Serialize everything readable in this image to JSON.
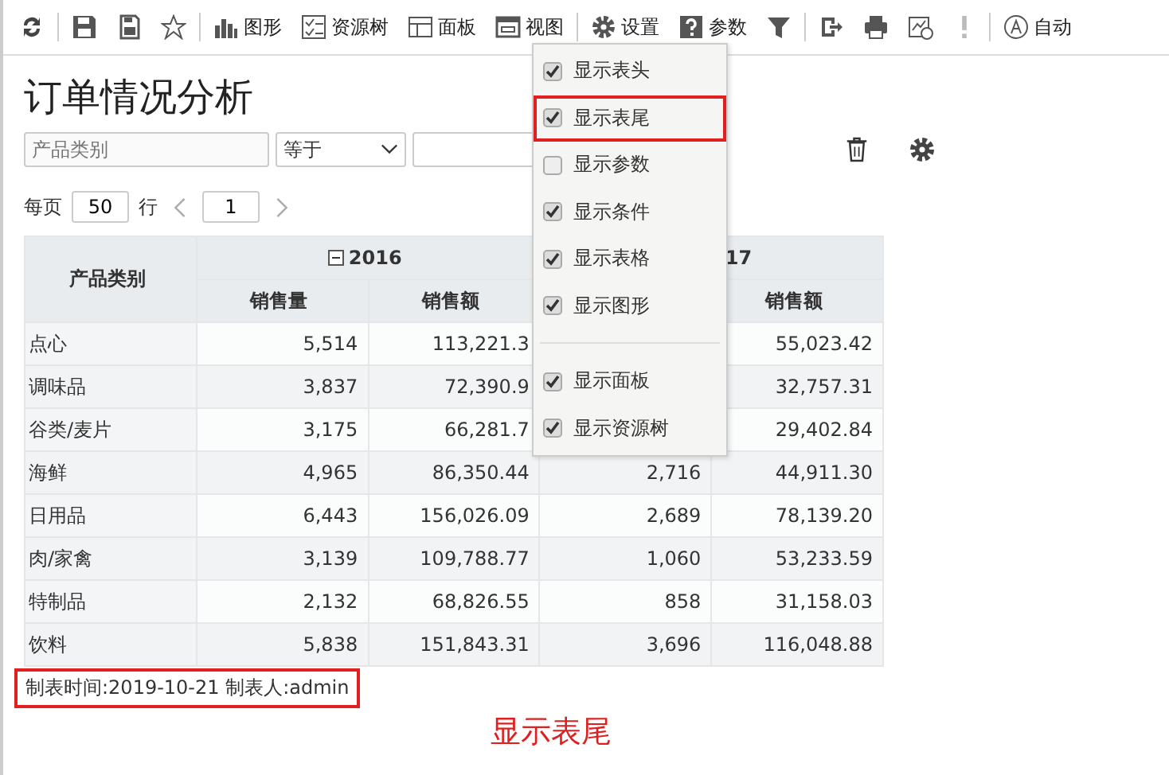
{
  "toolbar": [
    {
      "kind": "refresh"
    },
    {
      "kind": "sep"
    },
    {
      "kind": "save"
    },
    {
      "kind": "saveas"
    },
    {
      "kind": "star"
    },
    {
      "kind": "sep"
    },
    {
      "kind": "chart",
      "label": "图形"
    },
    {
      "kind": "tree",
      "label": "资源树"
    },
    {
      "kind": "panel",
      "label": "面板"
    },
    {
      "kind": "view",
      "label": "视图"
    },
    {
      "kind": "sep"
    },
    {
      "kind": "gear",
      "label": "设置"
    },
    {
      "kind": "help",
      "label": "参数"
    },
    {
      "kind": "filter"
    },
    {
      "kind": "sep"
    },
    {
      "kind": "export"
    },
    {
      "kind": "print"
    },
    {
      "kind": "schedule"
    },
    {
      "kind": "alert"
    },
    {
      "kind": "sep"
    },
    {
      "kind": "auto",
      "label": "自动"
    }
  ],
  "title": "订单情况分析",
  "filter": {
    "field_placeholder": "产品类别",
    "operator": "等于"
  },
  "pager": {
    "per_page_label": "每页",
    "per_page": "50",
    "rows_label": "行",
    "page": "1"
  },
  "table": {
    "corner": "产品类别",
    "years": [
      {
        "label": "2016",
        "collapse": true
      },
      {
        "label": "17",
        "collapse": false
      }
    ],
    "columns": [
      "销售量",
      "销售额",
      null,
      "销售额"
    ],
    "rows": [
      {
        "name": "点心",
        "cells": [
          "5,514",
          "113,221.3",
          null,
          "55,023.42"
        ]
      },
      {
        "name": "调味品",
        "cells": [
          "3,837",
          "72,390.9",
          null,
          "32,757.31"
        ]
      },
      {
        "name": "谷类/麦片",
        "cells": [
          "3,175",
          "66,281.7",
          null,
          "29,402.84"
        ]
      },
      {
        "name": "海鲜",
        "cells": [
          "4,965",
          "86,350.44",
          "2,716",
          "44,911.30"
        ]
      },
      {
        "name": "日用品",
        "cells": [
          "6,443",
          "156,026.09",
          "2,689",
          "78,139.20"
        ]
      },
      {
        "name": "肉/家禽",
        "cells": [
          "3,139",
          "109,788.77",
          "1,060",
          "53,233.59"
        ]
      },
      {
        "name": "特制品",
        "cells": [
          "2,132",
          "68,826.55",
          "858",
          "31,158.03"
        ]
      },
      {
        "name": "饮料",
        "cells": [
          "5,838",
          "151,843.31",
          "3,696",
          "116,048.88"
        ]
      }
    ]
  },
  "footer": {
    "text": "制表时间:2019-10-21 制表人:admin",
    "highlighted": true
  },
  "annotation": "显示表尾",
  "view_menu": [
    {
      "label": "显示表头",
      "checked": true,
      "highlighted": false
    },
    {
      "label": "显示表尾",
      "checked": true,
      "highlighted": true
    },
    {
      "label": "显示参数",
      "checked": false,
      "highlighted": false
    },
    {
      "label": "显示条件",
      "checked": true,
      "highlighted": false
    },
    {
      "label": "显示表格",
      "checked": true,
      "highlighted": false
    },
    {
      "label": "显示图形",
      "checked": true,
      "highlighted": false,
      "divider_after": true
    },
    {
      "label": "显示面板",
      "checked": true,
      "highlighted": false
    },
    {
      "label": "显示资源树",
      "checked": true,
      "highlighted": false
    }
  ]
}
